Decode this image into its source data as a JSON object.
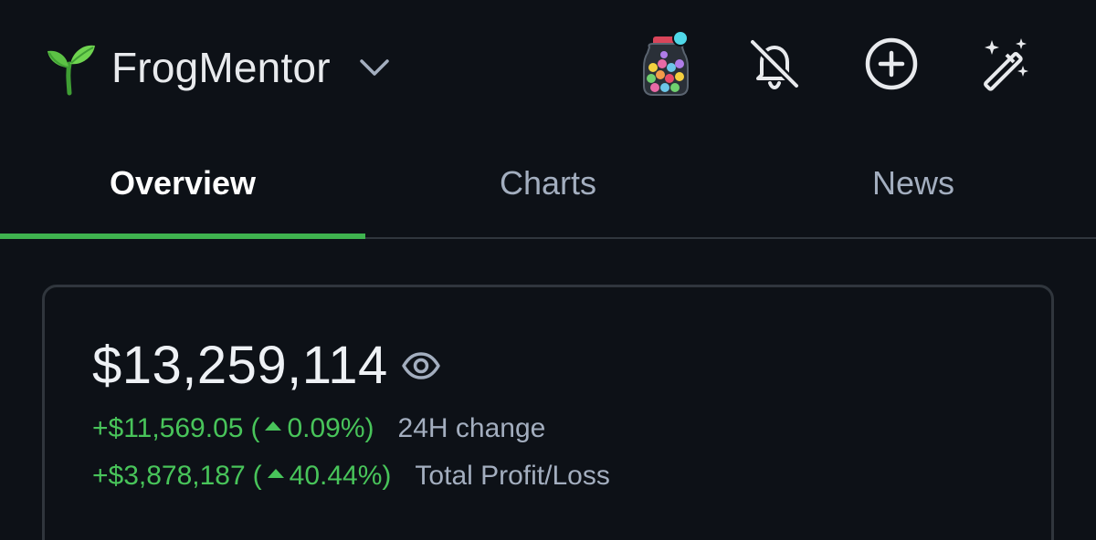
{
  "header": {
    "portfolio_name": "FrogMentor",
    "icons": {
      "portfolio": "sprout-icon",
      "dropdown": "chevron-down-icon",
      "jar": "candy-jar-icon",
      "alerts": "bell-off-icon",
      "add": "plus-circle-icon",
      "magic": "magic-wand-icon"
    }
  },
  "tabs": [
    {
      "label": "Overview",
      "active": true
    },
    {
      "label": "Charts",
      "active": false
    },
    {
      "label": "News",
      "active": false
    }
  ],
  "summary": {
    "balance": "$13,259,114",
    "change_24h": {
      "amount": "+$11,569.05",
      "open_paren": "(",
      "percent": "0.09%",
      "close_paren": ")",
      "label": "24H change"
    },
    "total_pl": {
      "amount": "+$3,878,187",
      "open_paren": "(",
      "percent": "40.44%",
      "close_paren": ")",
      "label": "Total Profit/Loss"
    }
  },
  "colors": {
    "background": "#0d1117",
    "accent_green": "#3fb34f",
    "positive": "#48c45a",
    "muted_text": "#a3aebf"
  }
}
